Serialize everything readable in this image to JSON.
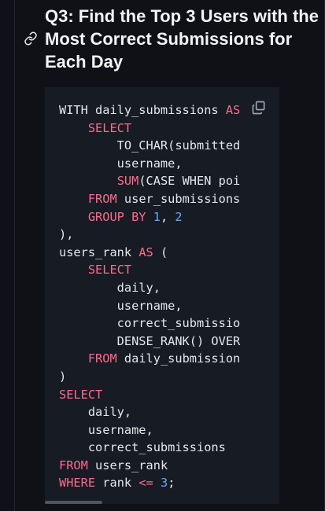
{
  "heading": {
    "title": "Q3: Find the Top 3 Users with the Most Correct Submissions for Each Day"
  },
  "code_card": {
    "lines": [
      {
        "segments": [
          {
            "text": "WITH daily_submissions ",
            "kind": "plain"
          },
          {
            "text": "AS",
            "kind": "kw"
          }
        ]
      },
      {
        "segments": [
          {
            "text": "    ",
            "kind": "plain"
          },
          {
            "text": "SELECT",
            "kind": "kw"
          }
        ]
      },
      {
        "segments": [
          {
            "text": "        TO_CHAR(submitted",
            "kind": "plain"
          }
        ]
      },
      {
        "segments": [
          {
            "text": "        username,",
            "kind": "plain"
          }
        ]
      },
      {
        "segments": [
          {
            "text": "        ",
            "kind": "plain"
          },
          {
            "text": "SUM",
            "kind": "fn"
          },
          {
            "text": "(CASE WHEN poi",
            "kind": "plain"
          }
        ]
      },
      {
        "segments": [
          {
            "text": "    ",
            "kind": "plain"
          },
          {
            "text": "FROM",
            "kind": "kw"
          },
          {
            "text": " user_submissions",
            "kind": "plain"
          }
        ]
      },
      {
        "segments": [
          {
            "text": "    ",
            "kind": "plain"
          },
          {
            "text": "GROUP BY",
            "kind": "kw"
          },
          {
            "text": " ",
            "kind": "plain"
          },
          {
            "text": "1",
            "kind": "num"
          },
          {
            "text": ", ",
            "kind": "plain"
          },
          {
            "text": "2",
            "kind": "num"
          }
        ]
      },
      {
        "segments": [
          {
            "text": "),",
            "kind": "plain"
          }
        ]
      },
      {
        "segments": [
          {
            "text": "users_rank ",
            "kind": "plain"
          },
          {
            "text": "AS",
            "kind": "kw"
          },
          {
            "text": " (",
            "kind": "plain"
          }
        ]
      },
      {
        "segments": [
          {
            "text": "    ",
            "kind": "plain"
          },
          {
            "text": "SELECT",
            "kind": "kw"
          }
        ]
      },
      {
        "segments": [
          {
            "text": "        daily,",
            "kind": "plain"
          }
        ]
      },
      {
        "segments": [
          {
            "text": "        username,",
            "kind": "plain"
          }
        ]
      },
      {
        "segments": [
          {
            "text": "        correct_submissio",
            "kind": "plain"
          }
        ]
      },
      {
        "segments": [
          {
            "text": "        DENSE_RANK() OVER",
            "kind": "plain"
          }
        ]
      },
      {
        "segments": [
          {
            "text": "    ",
            "kind": "plain"
          },
          {
            "text": "FROM",
            "kind": "kw"
          },
          {
            "text": " daily_submission",
            "kind": "plain"
          }
        ]
      },
      {
        "segments": [
          {
            "text": ")",
            "kind": "plain"
          }
        ]
      },
      {
        "segments": [
          {
            "text": "SELECT",
            "kind": "kw"
          }
        ]
      },
      {
        "segments": [
          {
            "text": "    daily,",
            "kind": "plain"
          }
        ]
      },
      {
        "segments": [
          {
            "text": "    username,",
            "kind": "plain"
          }
        ]
      },
      {
        "segments": [
          {
            "text": "    correct_submissions",
            "kind": "plain"
          }
        ]
      },
      {
        "segments": [
          {
            "text": "FROM",
            "kind": "kw"
          },
          {
            "text": " users_rank",
            "kind": "plain"
          }
        ]
      },
      {
        "segments": [
          {
            "text": "WHERE",
            "kind": "kw"
          },
          {
            "text": " rank ",
            "kind": "plain"
          },
          {
            "text": "<=",
            "kind": "op"
          },
          {
            "text": " ",
            "kind": "plain"
          },
          {
            "text": "3",
            "kind": "num"
          },
          {
            "text": ";",
            "kind": "plain"
          }
        ]
      }
    ]
  },
  "icons": {
    "heading_link": "link-icon",
    "copy": "copy-icon"
  },
  "colors": {
    "background": "#0f1117",
    "code_background": "#161b24",
    "keyword": "#ff6b8b",
    "number": "#67a7ff",
    "text": "#e5e7eb"
  }
}
